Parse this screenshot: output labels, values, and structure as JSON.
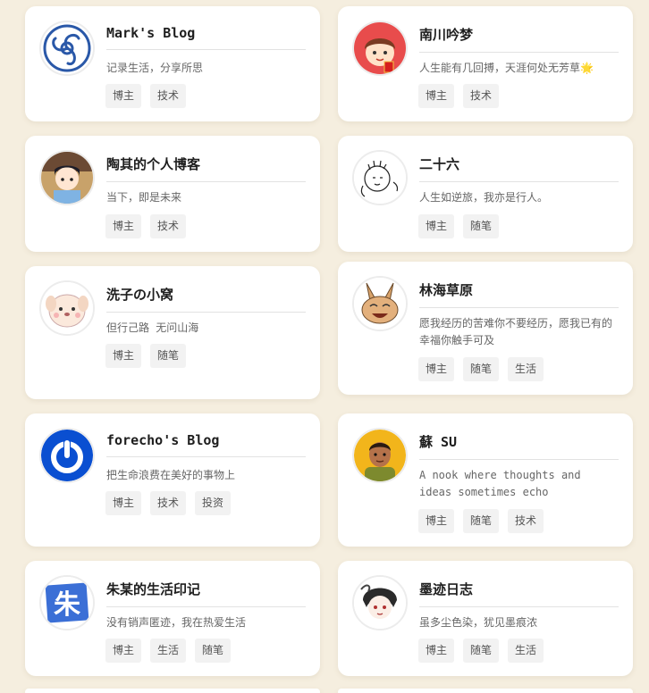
{
  "blogs": [
    {
      "name": "Mark's Blog",
      "desc": "记录生活，分享所思",
      "tags": [
        "博主",
        "技术"
      ]
    },
    {
      "name": "南川吟梦",
      "desc": "人生能有几回搏，天涯何处无芳草🌟",
      "tags": [
        "博主",
        "技术"
      ]
    },
    {
      "name": "陶其的个人博客",
      "desc": "当下，即是未来",
      "tags": [
        "博主",
        "技术"
      ]
    },
    {
      "name": "二十六",
      "desc": "人生如逆旅，我亦是行人。",
      "tags": [
        "博主",
        "随笔"
      ]
    },
    {
      "name": "洗子の小窝",
      "desc": "但行己路  无问山海",
      "tags": [
        "博主",
        "随笔"
      ]
    },
    {
      "name": "林海草原",
      "desc": "愿我经历的苦难你不要经历，愿我已有的幸福你触手可及",
      "tags": [
        "博主",
        "随笔",
        "生活"
      ]
    },
    {
      "name": "forecho's Blog",
      "desc": "把生命浪费在美好的事物上",
      "tags": [
        "博主",
        "技术",
        "投资"
      ]
    },
    {
      "name": "蘇 SU",
      "desc": "A nook where thoughts and ideas sometimes echo",
      "tags": [
        "博主",
        "随笔",
        "技术"
      ]
    },
    {
      "name": "朱某的生活印记",
      "desc": "没有销声匿迹，我在热爱生活",
      "tags": [
        "博主",
        "生活",
        "随笔"
      ]
    },
    {
      "name": "墨迹日志",
      "desc": "虽多尘色染，犹见墨痕浓",
      "tags": [
        "博主",
        "随笔",
        "生活"
      ]
    }
  ],
  "avatar_icons": [
    "swirl-pattern-icon",
    "cartoon-child-red-icon",
    "cartoon-girl-icon",
    "doodle-face-icon",
    "cartoon-puppy-icon",
    "cartoon-rabbit-icon",
    "power-ring-icon",
    "cartoon-man-icon",
    "zhu-character-icon",
    "ink-girl-icon"
  ],
  "avatar_text": {
    "zhu": "朱"
  },
  "colors": {
    "background": "#f5eedf",
    "card": "#ffffff",
    "tag_bg": "#f2f2f2"
  }
}
